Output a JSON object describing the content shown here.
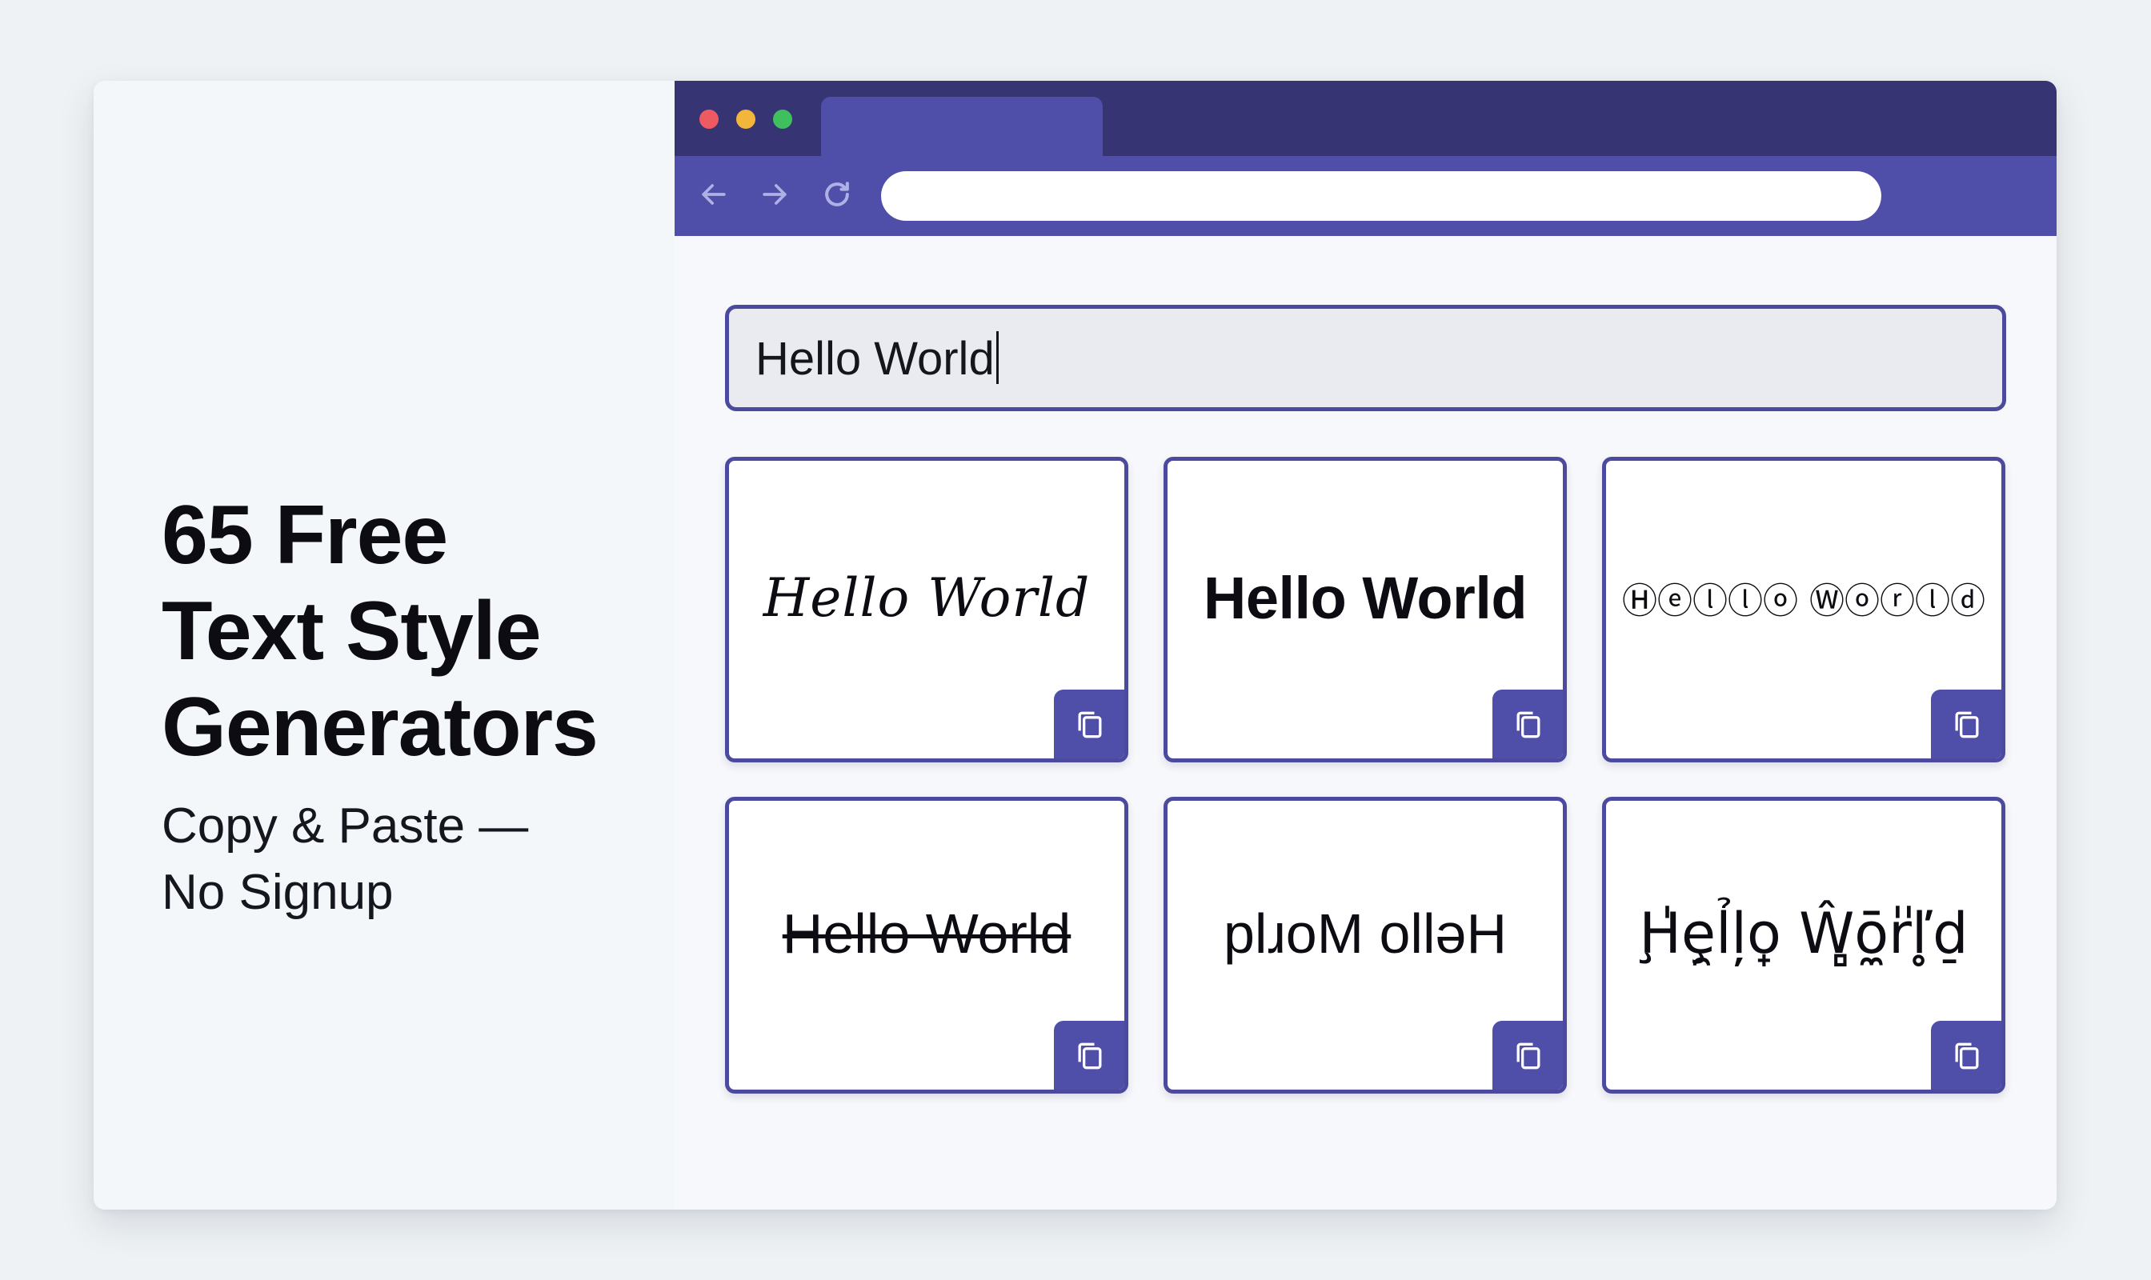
{
  "headline": {
    "lines": [
      "65 Free",
      "Text Style",
      "Generators"
    ]
  },
  "subheadline": {
    "lines": [
      "Copy & Paste —",
      "No Signup"
    ]
  },
  "browser": {
    "url": "",
    "window_controls": [
      "close",
      "minimize",
      "maximize"
    ],
    "nav_icons": [
      "arrow-left-icon",
      "arrow-right-icon",
      "reload-icon"
    ]
  },
  "input": {
    "value": "Hello World"
  },
  "styles": [
    {
      "name": "script",
      "text": "Hello World"
    },
    {
      "name": "bold",
      "text": "Hello World"
    },
    {
      "name": "circled",
      "text": "Ⓗⓔⓛⓛⓞ Ⓦⓞⓡⓛⓓ"
    },
    {
      "name": "strikethrough",
      "text": "Hello World"
    },
    {
      "name": "upside-down",
      "text": "plɹoM ollǝH"
    },
    {
      "name": "glitch",
      "text": "Ḩ̍ȩ̯l̉l̦o̟ Ŵ̻ō̼r̎ľ̥d̠"
    }
  ],
  "copy_icon": "copy-icon",
  "colors": {
    "accent": "#4f4ea9",
    "tabbar": "#373474",
    "border": "#4c4a9f",
    "background": "#eef2f4"
  }
}
